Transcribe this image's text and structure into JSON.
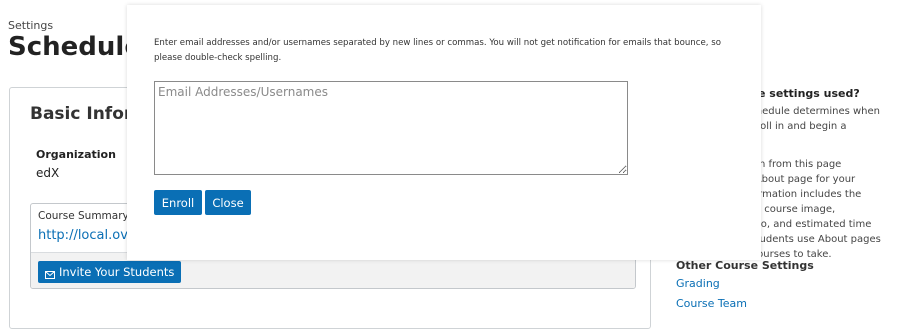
{
  "header": {
    "breadcrumb": "Settings",
    "title": "Schedule & Details"
  },
  "basic_info": {
    "title": "Basic Information",
    "organization_label": "Organization",
    "organization_value": "edX",
    "summary_label": "Course Summary Page",
    "summary_link": "http://local.overhang.io",
    "invite_button_label": "Invite Your Students",
    "invite_icon": "envelope-icon"
  },
  "sidebar": {
    "why_title": "How are these settings used?",
    "why_paragraph_1": "Your course's schedule determines when students can enroll in and begin a course.",
    "why_paragraph_2": "Other information from this page appears on the About page for your course. This information includes the course overview, course image, introduction video, and estimated time requirements. Students use About pages to choose new courses to take.",
    "other_title": "Other Course Settings",
    "links": {
      "grading": "Grading",
      "course_team": "Course Team"
    }
  },
  "modal": {
    "instructions": "Enter email addresses and/or usernames separated by new lines or commas. You will not get notification for emails that bounce, so please double-check spelling.",
    "textarea_placeholder": "Email Addresses/Usernames",
    "textarea_value": "",
    "enroll_label": "Enroll",
    "close_label": "Close"
  },
  "colors": {
    "accent": "#0a6fb5",
    "text": "#313131"
  }
}
